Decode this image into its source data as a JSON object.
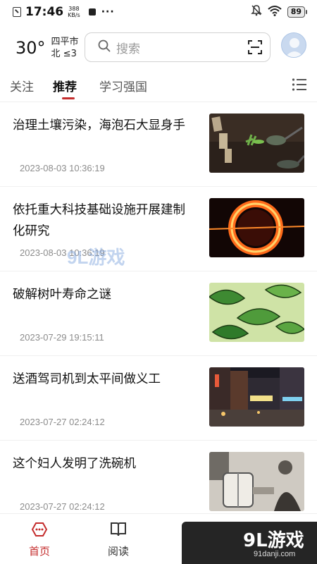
{
  "status_bar": {
    "time": "17:46",
    "net_speed_value": "388",
    "net_speed_unit": "KB/s",
    "dots": "···",
    "battery": "89"
  },
  "header": {
    "temperature": "30°",
    "city": "四平市",
    "wind": "北 ≤3",
    "search_placeholder": "搜索"
  },
  "tabs": [
    {
      "label": "关注"
    },
    {
      "label": "推荐"
    },
    {
      "label": "学习强国"
    }
  ],
  "news": [
    {
      "title": "治理土壤污染，海泡石大显身手",
      "date": "2023-08-03 10:36:19",
      "thumb": "soil-plants"
    },
    {
      "title": "依托重大科技基础设施开展建制化研究",
      "date": "2023-08-03 10:36:19",
      "thumb": "fire-ring"
    },
    {
      "title": "破解树叶寿命之谜",
      "date": "2023-07-29 19:15:11",
      "thumb": "green-leaves"
    },
    {
      "title": "送酒驾司机到太平间做义工",
      "date": "2023-07-27 02:24:12",
      "thumb": "night-street"
    },
    {
      "title": "这个妇人发明了洗碗机",
      "date": "2023-07-27 02:24:12",
      "thumb": "old-photo"
    }
  ],
  "bottom_nav": [
    {
      "label": "首页",
      "icon": "home-icon"
    },
    {
      "label": "阅读",
      "icon": "book-icon"
    }
  ],
  "watermark": {
    "brand": "9L游戏",
    "site": "91danji.com"
  },
  "colors": {
    "accent": "#c42c2c",
    "text": "#111111",
    "muted": "#8c8c8c"
  }
}
